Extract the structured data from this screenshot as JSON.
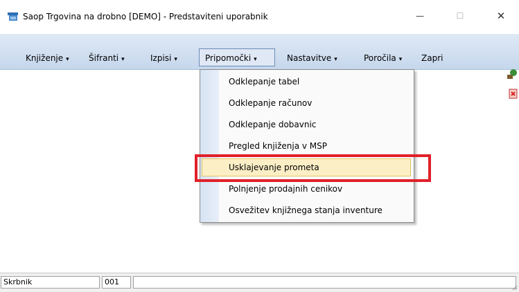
{
  "window": {
    "title": "Saop Trgovina na drobno [DEMO] - Predstaviteni uporabnik",
    "controls": {
      "minimize": "—",
      "maximize": "☐",
      "close": "✕"
    }
  },
  "menubar": {
    "items": [
      {
        "label": "Knjiženje",
        "caret": "▾"
      },
      {
        "label": "Šifranti",
        "caret": "▾"
      },
      {
        "label": "Izpisi",
        "caret": "▾"
      },
      {
        "label": "Pripomočki",
        "caret": "▾"
      },
      {
        "label": "Nastavitve",
        "caret": "▾"
      },
      {
        "label": "Poročila",
        "caret": "▾"
      },
      {
        "label": "Zapri",
        "caret": ""
      }
    ]
  },
  "dropdown": {
    "items": [
      "Odklepanje tabel",
      "Odklepanje računov",
      "Odklepanje dobavnic",
      "Pregled knjiženja v MSP",
      "Usklajevanje prometa",
      "Polnjenje prodajnih cenikov",
      "Osvežitev knjižnega stanja inventure"
    ],
    "highlighted_index": 4
  },
  "statusbar": {
    "user": "Skrbnik",
    "code": "001",
    "extra": ""
  },
  "colors": {
    "menubar_top": "#dfe9f5",
    "menubar_bottom": "#c6d7ec",
    "highlight": "#fcefc6",
    "callout": "#e0202a"
  }
}
